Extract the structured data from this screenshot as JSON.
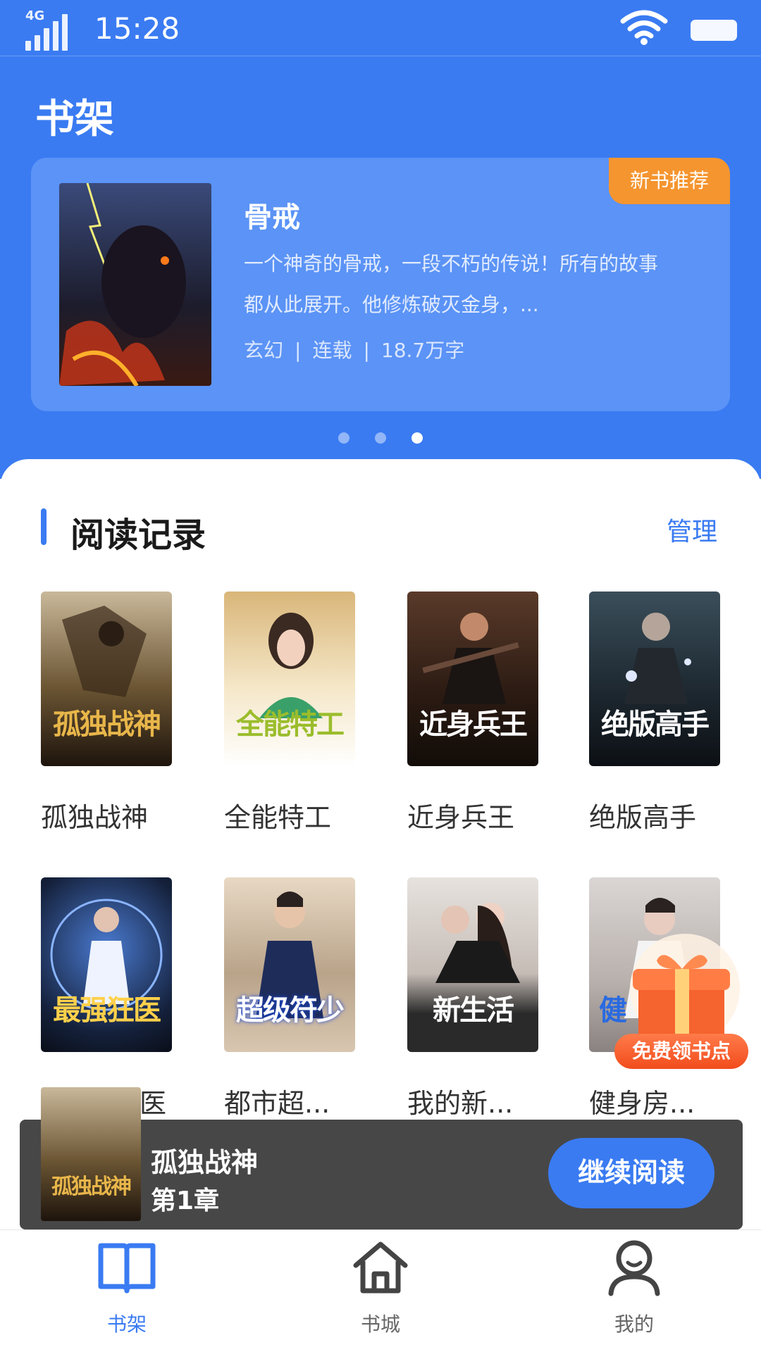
{
  "status_bar": {
    "network": "4G",
    "time": "15:28"
  },
  "page_title": "书架",
  "banner": {
    "badge": "新书推荐",
    "title": "骨戒",
    "description": "一个神奇的骨戒，一段不朽的传说！所有的故事都从此展开。他修炼破灭金身，...",
    "genre": "玄幻",
    "status": "连载",
    "word_count": "18.7万字",
    "meta_separator": "|"
  },
  "carousel": {
    "total": 3,
    "active_index": 2
  },
  "reading_history": {
    "title": "阅读记录",
    "manage_label": "管理",
    "books": [
      {
        "name": "孤独战神",
        "cover_text": "孤独战神"
      },
      {
        "name": "全能特工",
        "cover_text": "全能特工"
      },
      {
        "name": "近身兵王",
        "cover_text": "近身兵王"
      },
      {
        "name": "绝版高手",
        "cover_text": "绝版高手"
      },
      {
        "name": "医",
        "cover_text": "最强狂医"
      },
      {
        "name": "都市超...",
        "cover_text": "超级符少"
      },
      {
        "name": "我的新...",
        "cover_text": "新生活"
      },
      {
        "name": "健身房...",
        "cover_text": "健"
      }
    ]
  },
  "gift": {
    "label": "免费领书点"
  },
  "continue_reading": {
    "title": "孤独战神",
    "chapter": "第1章",
    "button_label": "继续阅读",
    "cover_text": "孤独战神"
  },
  "tabs": [
    {
      "label": "书架",
      "icon": "book-icon",
      "active": true
    },
    {
      "label": "书城",
      "icon": "home-icon",
      "active": false
    },
    {
      "label": "我的",
      "icon": "user-icon",
      "active": false
    }
  ],
  "colors": {
    "primary": "#3a7bf2",
    "badge": "#f5952f",
    "gift": "#f24c1c"
  }
}
